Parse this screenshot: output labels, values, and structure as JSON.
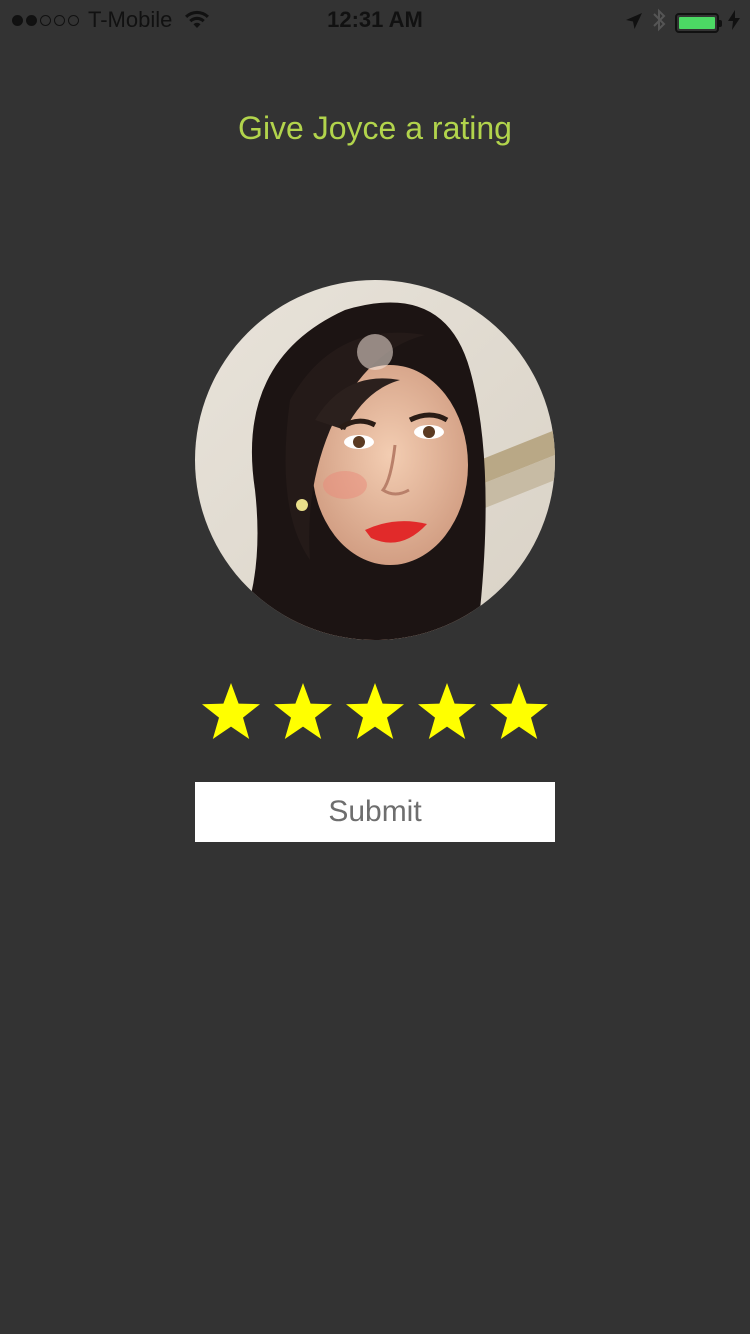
{
  "status_bar": {
    "signal_strength": 2,
    "signal_max": 5,
    "carrier": "T-Mobile",
    "time": "12:31 AM",
    "battery_level": 1.0,
    "battery_color": "#4cd964",
    "icons": [
      "wifi-icon",
      "location-arrow-icon",
      "bluetooth-icon",
      "battery-icon",
      "charging-bolt-icon"
    ]
  },
  "heading": "Give Joyce a rating",
  "avatar": {
    "description_icon": "profile-photo"
  },
  "rating": {
    "value": 5,
    "max": 5,
    "star_color": "#ffff00"
  },
  "submit_label": "Submit",
  "colors": {
    "background": "#333333",
    "heading": "#b2d44c",
    "button_bg": "#ffffff",
    "button_text": "#6e6e6e"
  }
}
